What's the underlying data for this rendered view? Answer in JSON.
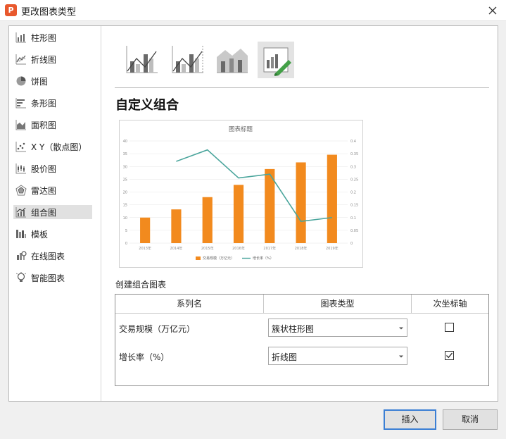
{
  "window": {
    "title": "更改图表类型",
    "logo_letter": "P"
  },
  "sidebar": {
    "items": [
      {
        "label": "柱形图",
        "icon": "column-chart-icon"
      },
      {
        "label": "折线图",
        "icon": "line-chart-icon"
      },
      {
        "label": "饼图",
        "icon": "pie-chart-icon"
      },
      {
        "label": "条形图",
        "icon": "bar-chart-icon"
      },
      {
        "label": "面积图",
        "icon": "area-chart-icon"
      },
      {
        "label": "X Y（散点图）",
        "icon": "scatter-chart-icon"
      },
      {
        "label": "股价图",
        "icon": "stock-chart-icon"
      },
      {
        "label": "雷达图",
        "icon": "radar-chart-icon"
      },
      {
        "label": "组合图",
        "icon": "combo-chart-icon",
        "active": true
      },
      {
        "label": "模板",
        "icon": "template-icon"
      },
      {
        "label": "在线图表",
        "icon": "online-chart-icon"
      },
      {
        "label": "智能图表",
        "icon": "smart-chart-icon"
      }
    ]
  },
  "content": {
    "section_title": "自定义组合",
    "combo_table_label": "创建组合图表",
    "headers": {
      "series": "系列名",
      "type": "图表类型",
      "secondary": "次坐标轴"
    },
    "rows": [
      {
        "name": "交易规模（万亿元）",
        "type": "簇状柱形图",
        "secondary": false
      },
      {
        "name": "增长率（%）",
        "type": "折线图",
        "secondary": true
      }
    ]
  },
  "chart_data": {
    "type": "bar",
    "title": "图表标题",
    "categories": [
      "2013年",
      "2014年",
      "2015年",
      "2016年",
      "2017年",
      "2018年",
      "2019年"
    ],
    "series": [
      {
        "name": "交易规模（万亿元）",
        "type": "bar",
        "axis": "primary",
        "color": "#f28a1e",
        "values": [
          10,
          13.2,
          18,
          22.8,
          29,
          31.6,
          34.6
        ]
      },
      {
        "name": "增长率（%）",
        "type": "line",
        "axis": "secondary",
        "color": "#4aa59c",
        "values": [
          null,
          0.32,
          0.365,
          0.255,
          0.27,
          0.085,
          0.1
        ]
      }
    ],
    "primary_axis": {
      "min": 0,
      "max": 40,
      "ticks": [
        "0",
        "5",
        "10",
        "15",
        "20",
        "25",
        "30",
        "35",
        "40"
      ]
    },
    "secondary_axis": {
      "min": 0,
      "max": 0.4,
      "ticks": [
        "0",
        "0.05",
        "0.1",
        "0.15",
        "0.2",
        "0.25",
        "0.3",
        "0.35",
        "0.4"
      ]
    },
    "legend": "bottom",
    "grid": true
  },
  "buttons": {
    "insert": "插入",
    "cancel": "取消"
  },
  "colors": {
    "accent": "#f28a1e",
    "line": "#4aa59c",
    "selected_border": "#3b7fd4",
    "check_green": "#43a047"
  }
}
